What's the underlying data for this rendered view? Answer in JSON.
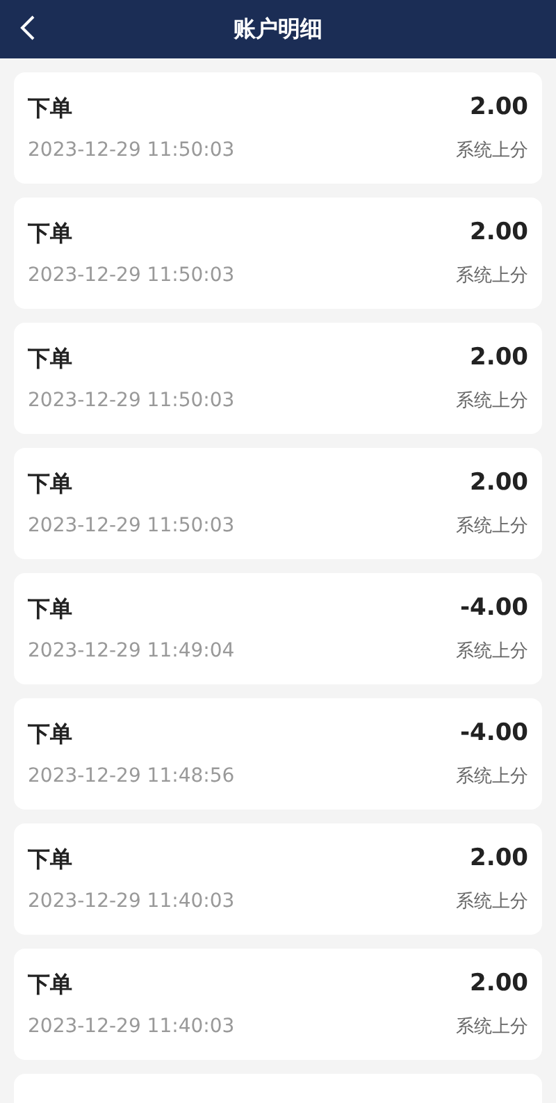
{
  "header": {
    "title": "账户明细"
  },
  "records": [
    {
      "title": "下单",
      "amount": "2.00",
      "time": "2023-12-29 11:50:03",
      "note": "系统上分"
    },
    {
      "title": "下单",
      "amount": "2.00",
      "time": "2023-12-29 11:50:03",
      "note": "系统上分"
    },
    {
      "title": "下单",
      "amount": "2.00",
      "time": "2023-12-29 11:50:03",
      "note": "系统上分"
    },
    {
      "title": "下单",
      "amount": "2.00",
      "time": "2023-12-29 11:50:03",
      "note": "系统上分"
    },
    {
      "title": "下单",
      "amount": "-4.00",
      "time": "2023-12-29 11:49:04",
      "note": "系统上分"
    },
    {
      "title": "下单",
      "amount": "-4.00",
      "time": "2023-12-29 11:48:56",
      "note": "系统上分"
    },
    {
      "title": "下单",
      "amount": "2.00",
      "time": "2023-12-29 11:40:03",
      "note": "系统上分"
    },
    {
      "title": "下单",
      "amount": "2.00",
      "time": "2023-12-29 11:40:03",
      "note": "系统上分"
    }
  ]
}
